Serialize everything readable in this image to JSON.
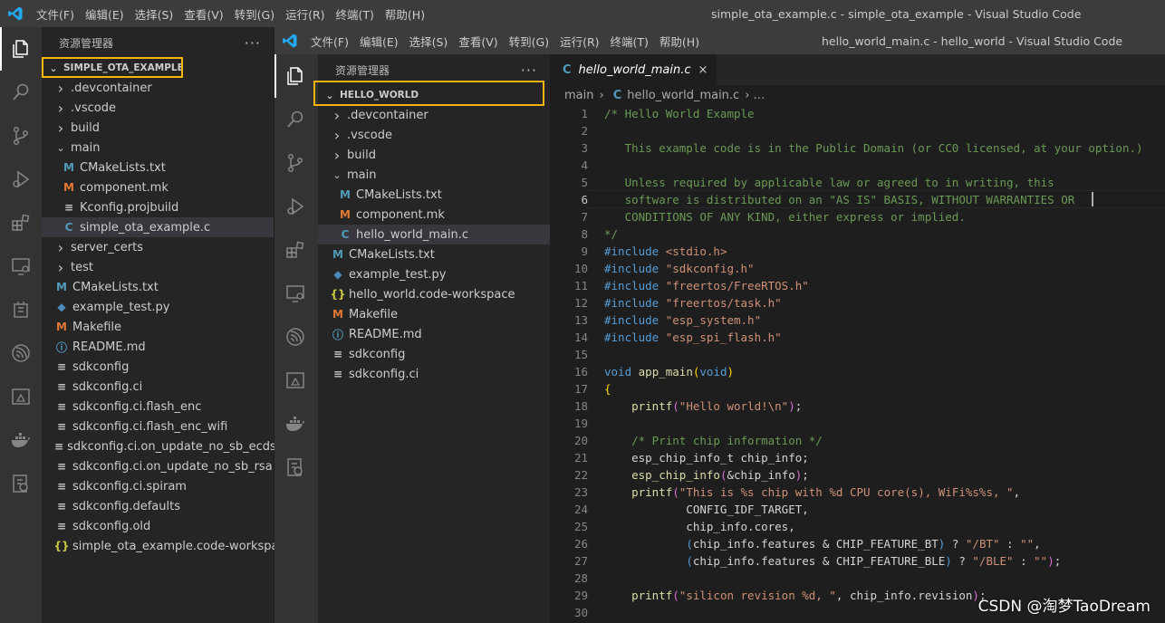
{
  "back_window": {
    "menu": [
      "文件(F)",
      "编辑(E)",
      "选择(S)",
      "查看(V)",
      "转到(G)",
      "运行(R)",
      "终端(T)",
      "帮助(H)"
    ],
    "title": "simple_ota_example.c - simple_ota_example - Visual Studio Code",
    "explorer_title": "资源管理器",
    "root": "SIMPLE_OTA_EXAMPLE",
    "tree": [
      {
        "label": ".devcontainer",
        "type": "folder",
        "expanded": false,
        "depth": 1
      },
      {
        "label": ".vscode",
        "type": "folder",
        "expanded": false,
        "depth": 1
      },
      {
        "label": "build",
        "type": "folder",
        "expanded": false,
        "depth": 1
      },
      {
        "label": "main",
        "type": "folder",
        "expanded": true,
        "depth": 1
      },
      {
        "label": "CMakeLists.txt",
        "type": "cmake",
        "depth": 2
      },
      {
        "label": "component.mk",
        "type": "make",
        "depth": 2
      },
      {
        "label": "Kconfig.projbuild",
        "type": "lines",
        "depth": 2
      },
      {
        "label": "simple_ota_example.c",
        "type": "c",
        "depth": 2,
        "selected": true
      },
      {
        "label": "server_certs",
        "type": "folder",
        "expanded": false,
        "depth": 1
      },
      {
        "label": "test",
        "type": "folder",
        "expanded": false,
        "depth": 1
      },
      {
        "label": "CMakeLists.txt",
        "type": "cmake",
        "depth": 1
      },
      {
        "label": "example_test.py",
        "type": "py",
        "depth": 1
      },
      {
        "label": "Makefile",
        "type": "make",
        "depth": 1
      },
      {
        "label": "README.md",
        "type": "info",
        "depth": 1
      },
      {
        "label": "sdkconfig",
        "type": "lines",
        "depth": 1
      },
      {
        "label": "sdkconfig.ci",
        "type": "lines",
        "depth": 1
      },
      {
        "label": "sdkconfig.ci.flash_enc",
        "type": "lines",
        "depth": 1
      },
      {
        "label": "sdkconfig.ci.flash_enc_wifi",
        "type": "lines",
        "depth": 1
      },
      {
        "label": "sdkconfig.ci.on_update_no_sb_ecdsa",
        "type": "lines",
        "depth": 1
      },
      {
        "label": "sdkconfig.ci.on_update_no_sb_rsa",
        "type": "lines",
        "depth": 1
      },
      {
        "label": "sdkconfig.ci.spiram",
        "type": "lines",
        "depth": 1
      },
      {
        "label": "sdkconfig.defaults",
        "type": "lines",
        "depth": 1
      },
      {
        "label": "sdkconfig.old",
        "type": "lines",
        "depth": 1
      },
      {
        "label": "simple_ota_example.code-workspace",
        "type": "json",
        "depth": 1
      }
    ]
  },
  "front_window": {
    "menu": [
      "文件(F)",
      "编辑(E)",
      "选择(S)",
      "查看(V)",
      "转到(G)",
      "运行(R)",
      "终端(T)",
      "帮助(H)"
    ],
    "title": "hello_world_main.c - hello_world - Visual Studio Code",
    "explorer_title": "资源管理器",
    "root": "HELLO_WORLD",
    "tree": [
      {
        "label": ".devcontainer",
        "type": "folder",
        "expanded": false,
        "depth": 1
      },
      {
        "label": ".vscode",
        "type": "folder",
        "expanded": false,
        "depth": 1
      },
      {
        "label": "build",
        "type": "folder",
        "expanded": false,
        "depth": 1
      },
      {
        "label": "main",
        "type": "folder",
        "expanded": true,
        "depth": 1
      },
      {
        "label": "CMakeLists.txt",
        "type": "cmake",
        "depth": 2
      },
      {
        "label": "component.mk",
        "type": "make",
        "depth": 2
      },
      {
        "label": "hello_world_main.c",
        "type": "c",
        "depth": 2,
        "selected": true
      },
      {
        "label": "CMakeLists.txt",
        "type": "cmake",
        "depth": 1
      },
      {
        "label": "example_test.py",
        "type": "py",
        "depth": 1
      },
      {
        "label": "hello_world.code-workspace",
        "type": "json",
        "depth": 1
      },
      {
        "label": "Makefile",
        "type": "make",
        "depth": 1
      },
      {
        "label": "README.md",
        "type": "info",
        "depth": 1
      },
      {
        "label": "sdkconfig",
        "type": "lines",
        "depth": 1
      },
      {
        "label": "sdkconfig.ci",
        "type": "lines",
        "depth": 1
      }
    ],
    "tab": {
      "icon": "C",
      "label": "hello_world_main.c",
      "close": "×"
    },
    "breadcrumb": {
      "folder": "main",
      "sep": "›",
      "file": "hello_world_main.c",
      "more": "…"
    },
    "current_line": 6,
    "code": [
      {
        "n": 1,
        "segs": [
          [
            "com",
            "/* Hello World Example"
          ]
        ]
      },
      {
        "n": 2,
        "segs": []
      },
      {
        "n": 3,
        "segs": [
          [
            "com",
            "   This example code is in the Public Domain (or CC0 licensed, at your option.)"
          ]
        ]
      },
      {
        "n": 4,
        "segs": []
      },
      {
        "n": 5,
        "segs": [
          [
            "com",
            "   Unless required by applicable law or agreed to in writing, this"
          ]
        ]
      },
      {
        "n": 6,
        "segs": [
          [
            "com",
            "   software is distributed on an \"AS IS\" BASIS, WITHOUT WARRANTIES OR"
          ]
        ]
      },
      {
        "n": 7,
        "segs": [
          [
            "com",
            "   CONDITIONS OF ANY KIND, either express or implied."
          ]
        ]
      },
      {
        "n": 8,
        "segs": [
          [
            "com",
            "*/"
          ]
        ]
      },
      {
        "n": 9,
        "segs": [
          [
            "kw",
            "#include"
          ],
          [
            "def",
            " "
          ],
          [
            "str",
            "<stdio.h>"
          ]
        ]
      },
      {
        "n": 10,
        "segs": [
          [
            "kw",
            "#include"
          ],
          [
            "def",
            " "
          ],
          [
            "str",
            "\"sdkconfig.h\""
          ]
        ]
      },
      {
        "n": 11,
        "segs": [
          [
            "kw",
            "#include"
          ],
          [
            "def",
            " "
          ],
          [
            "str",
            "\"freertos/FreeRTOS.h\""
          ]
        ]
      },
      {
        "n": 12,
        "segs": [
          [
            "kw",
            "#include"
          ],
          [
            "def",
            " "
          ],
          [
            "str",
            "\"freertos/task.h\""
          ]
        ]
      },
      {
        "n": 13,
        "segs": [
          [
            "kw",
            "#include"
          ],
          [
            "def",
            " "
          ],
          [
            "str",
            "\"esp_system.h\""
          ]
        ]
      },
      {
        "n": 14,
        "segs": [
          [
            "kw",
            "#include"
          ],
          [
            "def",
            " "
          ],
          [
            "str",
            "\"esp_spi_flash.h\""
          ]
        ]
      },
      {
        "n": 15,
        "segs": []
      },
      {
        "n": 16,
        "segs": [
          [
            "kw",
            "void"
          ],
          [
            "def",
            " "
          ],
          [
            "fn",
            "app_main"
          ],
          [
            "brk",
            "("
          ],
          [
            "kw",
            "void"
          ],
          [
            "brk",
            ")"
          ]
        ]
      },
      {
        "n": 17,
        "segs": [
          [
            "brk",
            "{"
          ]
        ]
      },
      {
        "n": 18,
        "segs": [
          [
            "def",
            "    "
          ],
          [
            "fn",
            "printf"
          ],
          [
            "brk2",
            "("
          ],
          [
            "str",
            "\"Hello world!\\n\""
          ],
          [
            "brk2",
            ")"
          ],
          [
            "def",
            ";"
          ]
        ]
      },
      {
        "n": 19,
        "segs": []
      },
      {
        "n": 20,
        "segs": [
          [
            "def",
            "    "
          ],
          [
            "com",
            "/* Print chip information */"
          ]
        ]
      },
      {
        "n": 21,
        "segs": [
          [
            "def",
            "    esp_chip_info_t chip_info;"
          ]
        ]
      },
      {
        "n": 22,
        "segs": [
          [
            "def",
            "    "
          ],
          [
            "fn",
            "esp_chip_info"
          ],
          [
            "brk2",
            "("
          ],
          [
            "def",
            "&chip_info"
          ],
          [
            "brk2",
            ")"
          ],
          [
            "def",
            ";"
          ]
        ]
      },
      {
        "n": 23,
        "segs": [
          [
            "def",
            "    "
          ],
          [
            "fn",
            "printf"
          ],
          [
            "brk2",
            "("
          ],
          [
            "str",
            "\"This is %s chip with %d CPU core(s), WiFi%s%s, \""
          ],
          [
            "def",
            ","
          ]
        ]
      },
      {
        "n": 24,
        "segs": [
          [
            "def",
            "            CONFIG_IDF_TARGET,"
          ]
        ]
      },
      {
        "n": 25,
        "segs": [
          [
            "def",
            "            chip_info.cores,"
          ]
        ]
      },
      {
        "n": 26,
        "segs": [
          [
            "def",
            "            "
          ],
          [
            "kw",
            "("
          ],
          [
            "def",
            "chip_info.features & CHIP_FEATURE_BT"
          ],
          [
            "kw",
            ")"
          ],
          [
            "def",
            " ? "
          ],
          [
            "str",
            "\"/BT\""
          ],
          [
            "def",
            " : "
          ],
          [
            "str",
            "\"\""
          ],
          [
            "def",
            ","
          ]
        ]
      },
      {
        "n": 27,
        "segs": [
          [
            "def",
            "            "
          ],
          [
            "kw",
            "("
          ],
          [
            "def",
            "chip_info.features & CHIP_FEATURE_BLE"
          ],
          [
            "kw",
            ")"
          ],
          [
            "def",
            " ? "
          ],
          [
            "str",
            "\"/BLE\""
          ],
          [
            "def",
            " : "
          ],
          [
            "str",
            "\"\""
          ],
          [
            "brk2",
            ")"
          ],
          [
            "def",
            ";"
          ]
        ]
      },
      {
        "n": 28,
        "segs": []
      },
      {
        "n": 29,
        "segs": [
          [
            "def",
            "    "
          ],
          [
            "fn",
            "printf"
          ],
          [
            "brk2",
            "("
          ],
          [
            "str",
            "\"silicon revision %d, \""
          ],
          [
            "def",
            ", chip_info.revision"
          ],
          [
            "brk2",
            ")"
          ],
          [
            "def",
            ";"
          ]
        ]
      },
      {
        "n": 30,
        "segs": []
      }
    ]
  },
  "watermark": "CSDN @淘梦TaoDream",
  "colors": {
    "highlight_box": "#f5b50f",
    "accent_blue": "#007acc"
  }
}
